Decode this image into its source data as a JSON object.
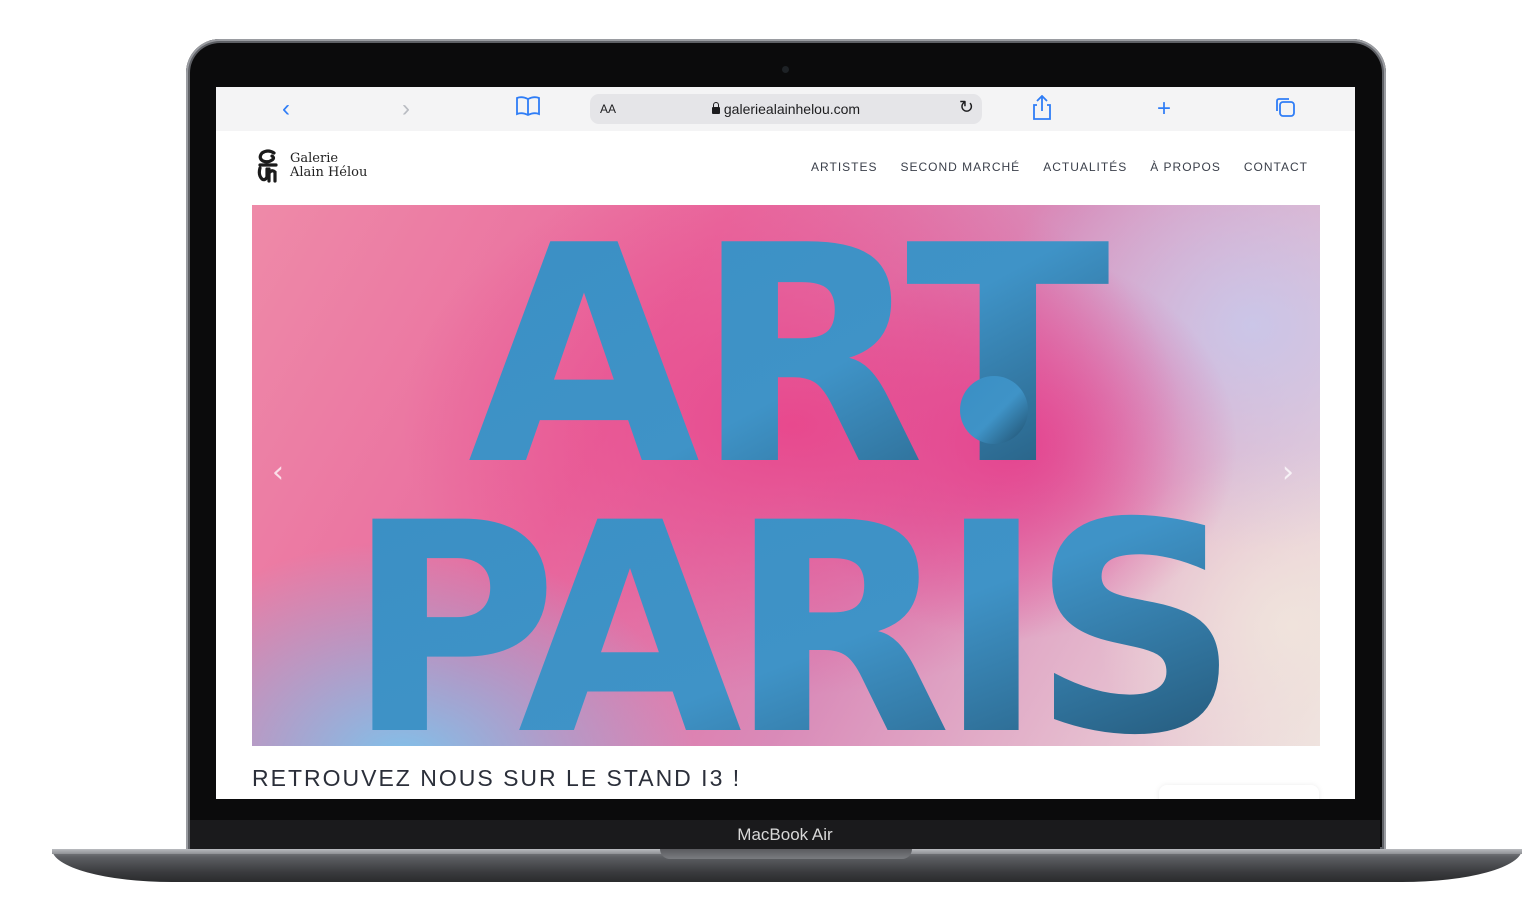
{
  "device": {
    "label": "MacBook Air"
  },
  "browser": {
    "reader_label": "AA",
    "url": "galeriealainhelou.com",
    "icons": [
      "back-icon",
      "forward-icon",
      "bookmarks-icon",
      "lock-icon",
      "reload-icon",
      "share-icon",
      "new-tab-icon",
      "tabs-icon"
    ]
  },
  "site": {
    "logo_line1": "Galerie",
    "logo_line2": "Alain Hélou",
    "nav": [
      "ARTISTES",
      "SECOND MARCHÉ",
      "ACTUALITÉS",
      "À PROPOS",
      "CONTACT"
    ],
    "hero": {
      "line1": "ART",
      "line2": "PARIS",
      "accent_colors": [
        "#3a8fc4",
        "#e85a9a"
      ]
    },
    "caption": "RETROUVEZ NOUS SUR LE STAND I3 !"
  }
}
